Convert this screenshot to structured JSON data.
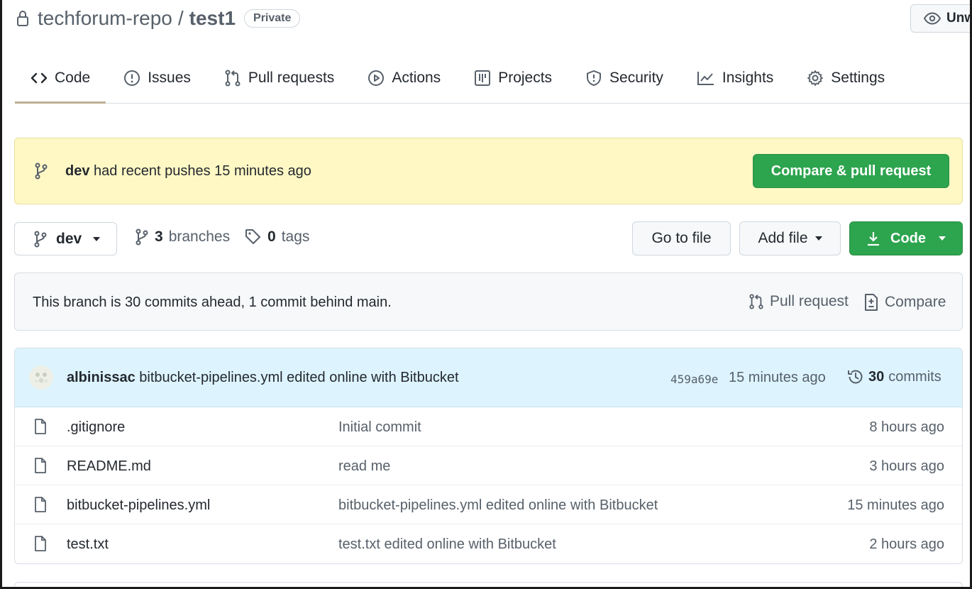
{
  "repo": {
    "owner": "techforum-repo",
    "slash": "/",
    "name": "test1",
    "visibility": "Private",
    "watch_label": "Unwa"
  },
  "tabs": [
    {
      "label": "Code",
      "icon": "code-icon",
      "active": true
    },
    {
      "label": "Issues",
      "icon": "issue-icon"
    },
    {
      "label": "Pull requests",
      "icon": "pull-request-icon"
    },
    {
      "label": "Actions",
      "icon": "play-icon"
    },
    {
      "label": "Projects",
      "icon": "project-icon"
    },
    {
      "label": "Security",
      "icon": "shield-icon"
    },
    {
      "label": "Insights",
      "icon": "graph-icon"
    },
    {
      "label": "Settings",
      "icon": "gear-icon"
    }
  ],
  "flash": {
    "branch": "dev",
    "text": "had recent pushes 15 minutes ago",
    "button": "Compare & pull request"
  },
  "branch_bar": {
    "current_branch": "dev",
    "branches_count": "3",
    "branches_label": "branches",
    "tags_count": "0",
    "tags_label": "tags",
    "go_to_file": "Go to file",
    "add_file": "Add file",
    "code": "Code"
  },
  "ahead": {
    "text": "This branch is 30 commits ahead, 1 commit behind main.",
    "pull_request": "Pull request",
    "compare": "Compare"
  },
  "latest_commit": {
    "author": "albinissac",
    "message": "bitbucket-pipelines.yml edited online with Bitbucket",
    "sha": "459a69e",
    "time": "15 minutes ago",
    "commits_count": "30",
    "commits_label": "commits"
  },
  "files": [
    {
      "name": ".gitignore",
      "message": "Initial commit",
      "age": "8 hours ago"
    },
    {
      "name": "README.md",
      "message": "read me",
      "age": "3 hours ago"
    },
    {
      "name": "bitbucket-pipelines.yml",
      "message": "bitbucket-pipelines.yml edited online with Bitbucket",
      "age": "15 minutes ago"
    },
    {
      "name": "test.txt",
      "message": "test.txt edited online with Bitbucket",
      "age": "2 hours ago"
    }
  ],
  "colors": {
    "accent_green": "#2da44e",
    "flash_bg": "#fff8c5",
    "commit_bg": "#ddf4ff"
  }
}
